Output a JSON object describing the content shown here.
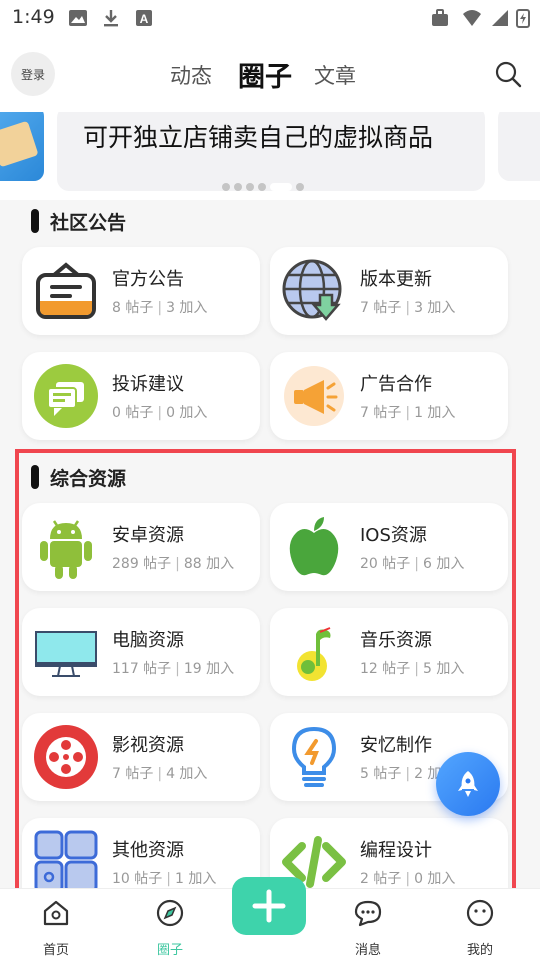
{
  "status_bar": {
    "time": "1:49"
  },
  "header": {
    "login_label": "登录",
    "tabs": [
      {
        "label": "动态",
        "active": false
      },
      {
        "label": "圈子",
        "active": true
      },
      {
        "label": "文章",
        "active": false
      }
    ]
  },
  "banner": {
    "title": "可开独立店铺卖自己的虚拟商品",
    "page_count": 6,
    "active_index": 4
  },
  "sections": [
    {
      "title": "社区公告",
      "items": [
        {
          "name": "官方公告",
          "posts": "8 帖子",
          "joins": "3 加入",
          "icon": "announcement-box-icon"
        },
        {
          "name": "版本更新",
          "posts": "7 帖子",
          "joins": "3 加入",
          "icon": "globe-download-icon"
        },
        {
          "name": "投诉建议",
          "posts": "0 帖子",
          "joins": "0 加入",
          "icon": "chat-bubble-icon"
        },
        {
          "name": "广告合作",
          "posts": "7 帖子",
          "joins": "1 加入",
          "icon": "megaphone-icon"
        }
      ]
    },
    {
      "title": "综合资源",
      "items": [
        {
          "name": "安卓资源",
          "posts": "289 帖子",
          "joins": "88 加入",
          "icon": "android-icon"
        },
        {
          "name": "IOS资源",
          "posts": "20 帖子",
          "joins": "6 加入",
          "icon": "apple-icon"
        },
        {
          "name": "电脑资源",
          "posts": "117 帖子",
          "joins": "19 加入",
          "icon": "monitor-icon"
        },
        {
          "name": "音乐资源",
          "posts": "12 帖子",
          "joins": "5 加入",
          "icon": "music-note-icon"
        },
        {
          "name": "影视资源",
          "posts": "7 帖子",
          "joins": "4 加入",
          "icon": "film-reel-icon"
        },
        {
          "name": "安忆制作",
          "posts": "5 帖子",
          "joins": "2 加入",
          "icon": "lightbulb-icon"
        },
        {
          "name": "其他资源",
          "posts": "10 帖子",
          "joins": "1 加入",
          "icon": "grid-apps-icon"
        },
        {
          "name": "编程设计",
          "posts": "2 帖子",
          "joins": "0 加入",
          "icon": "code-brackets-icon"
        }
      ]
    }
  ],
  "bottom_nav": [
    {
      "label": "首页",
      "icon": "home-icon",
      "active": false
    },
    {
      "label": "圈子",
      "icon": "compass-icon",
      "active": true
    },
    {
      "label": "消息",
      "icon": "chat-icon",
      "active": false
    },
    {
      "label": "我的",
      "icon": "smiley-icon",
      "active": false
    }
  ],
  "colors": {
    "accent": "#3ed3ab",
    "highlight_border": "#f0464f",
    "fab": "#2a79f0"
  }
}
